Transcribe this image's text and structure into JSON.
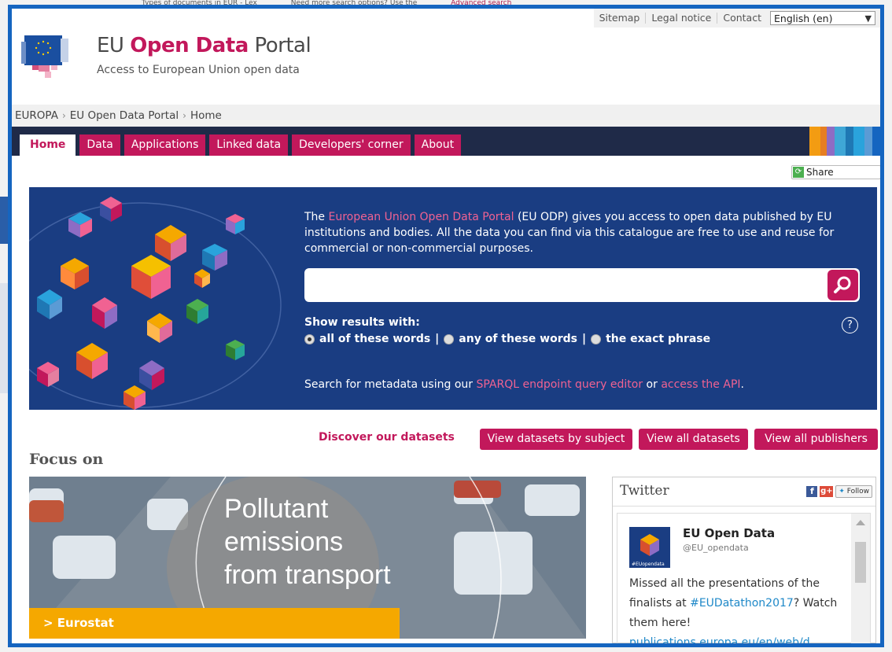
{
  "background_page": {
    "top_text_left": "Types of documents in EUR - Lex",
    "top_text_right": "Need more search options? Use the",
    "top_text_link": "Advanced search"
  },
  "utility": {
    "sitemap": "Sitemap",
    "legal": "Legal notice",
    "contact": "Contact",
    "language": "English (en)"
  },
  "brand": {
    "eu": "EU",
    "accent": "Open Data",
    "rest": "Portal",
    "subtitle": "Access to European Union open data"
  },
  "breadcrumb": [
    "EUROPA",
    "EU Open Data Portal",
    "Home"
  ],
  "nav": {
    "tabs": [
      "Home",
      "Data",
      "Applications",
      "Linked data",
      "Developers' corner",
      "About"
    ],
    "active": "Home"
  },
  "share": "Share",
  "hero": {
    "text_pre": "The",
    "text_link": "European Union Open Data Portal",
    "text_post": "(EU ODP) gives you access to open data published by EU institutions and bodies. All the data you can find via this catalogue are free to use and reuse for commercial or non-commercial purposes.",
    "search_value": "",
    "show_label": "Show results with:",
    "options": [
      "all of these words",
      "any of these words",
      "the exact phrase"
    ],
    "selected_option": "all of these words",
    "help": "?",
    "sparql_pre": "Search for metadata using our",
    "sparql_link": "SPARQL endpoint query editor",
    "sparql_mid": "or",
    "api_link": "access the API",
    "sparql_end": "."
  },
  "discover": {
    "label": "Discover our datasets",
    "buttons": [
      "View datasets by subject",
      "View all datasets",
      "View all publishers"
    ]
  },
  "focus": {
    "title": "Focus on",
    "headline_1": "Pollutant",
    "headline_2": "emissions",
    "headline_3": "from transport",
    "source": "> Eurostat"
  },
  "twitter": {
    "title": "Twitter",
    "fb": "f",
    "gplus": "g+",
    "follow": "Follow",
    "name": "EU Open Data",
    "handle": "@EU_opendata",
    "avatar_tag": "#EUopendata",
    "text_1": "Missed all the presentations of the finalists at",
    "hashtag": "#EUDatathon2017",
    "text_2": "? Watch them here!",
    "link": "publications.europa.eu/en/web/d"
  },
  "colors": {
    "accent": "#c2185b",
    "navy": "#1f2a48",
    "hero": "#1a3d82",
    "frame": "#1565c0",
    "eurostat": "#f5a800"
  }
}
